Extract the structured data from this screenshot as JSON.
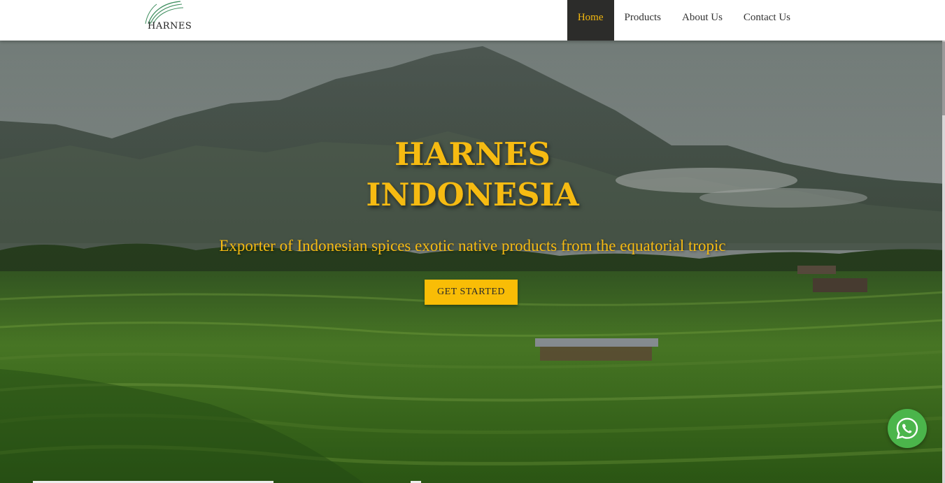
{
  "brand": {
    "logo_text": "HARNES"
  },
  "nav": {
    "items": [
      {
        "label": "Home",
        "active": true
      },
      {
        "label": "Products",
        "active": false
      },
      {
        "label": "About Us",
        "active": false
      },
      {
        "label": "Contact Us",
        "active": false
      }
    ]
  },
  "hero": {
    "title_line1": "HARNES",
    "title_line2": "INDONESIA",
    "subtitle": "Exporter of Indonesian spices exotic native products from the equatorial tropic",
    "cta_label": "GET STARTED"
  },
  "colors": {
    "accent": "#f6bb12",
    "nav_active_bg": "#2c2c2a",
    "whatsapp": "#4bb54b"
  },
  "icons": {
    "chat": "whatsapp-icon"
  }
}
